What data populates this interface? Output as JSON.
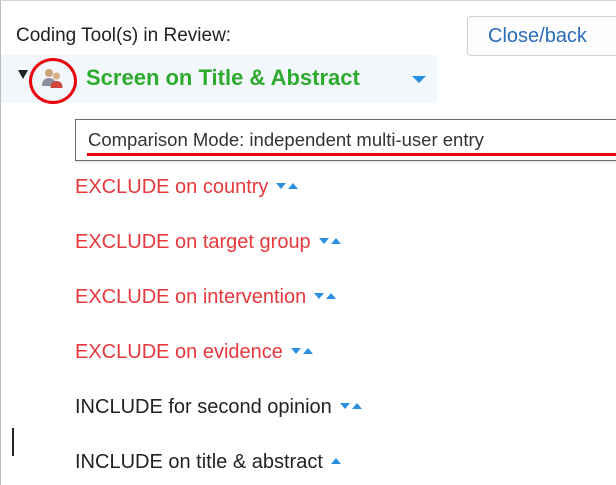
{
  "header": {
    "title": "Coding Tool(s) in Review:",
    "close_label": "Close/back"
  },
  "tool": {
    "name": "Screen on Title & Abstract",
    "icon": "users-icon",
    "highlight_color": "#e8000b"
  },
  "tooltip": {
    "text": "Comparison Mode: independent multi-user entry"
  },
  "codes": [
    {
      "label": "EXCLUDE on country",
      "kind": "exclude",
      "arrows": [
        "down",
        "up"
      ]
    },
    {
      "label": "EXCLUDE on target group",
      "kind": "exclude",
      "arrows": [
        "down",
        "up"
      ]
    },
    {
      "label": "EXCLUDE on intervention",
      "kind": "exclude",
      "arrows": [
        "down",
        "up"
      ]
    },
    {
      "label": "EXCLUDE on evidence",
      "kind": "exclude",
      "arrows": [
        "down",
        "up"
      ]
    },
    {
      "label": "INCLUDE for second opinion",
      "kind": "include",
      "arrows": [
        "down",
        "up"
      ]
    },
    {
      "label": "INCLUDE on title & abstract",
      "kind": "include",
      "arrows": [
        "up"
      ]
    }
  ],
  "colors": {
    "tool_title": "#2eaa2e",
    "exclude": "#e8383d",
    "include": "#222222",
    "accent": "#2a8fe0",
    "link": "#2a6ebb"
  }
}
